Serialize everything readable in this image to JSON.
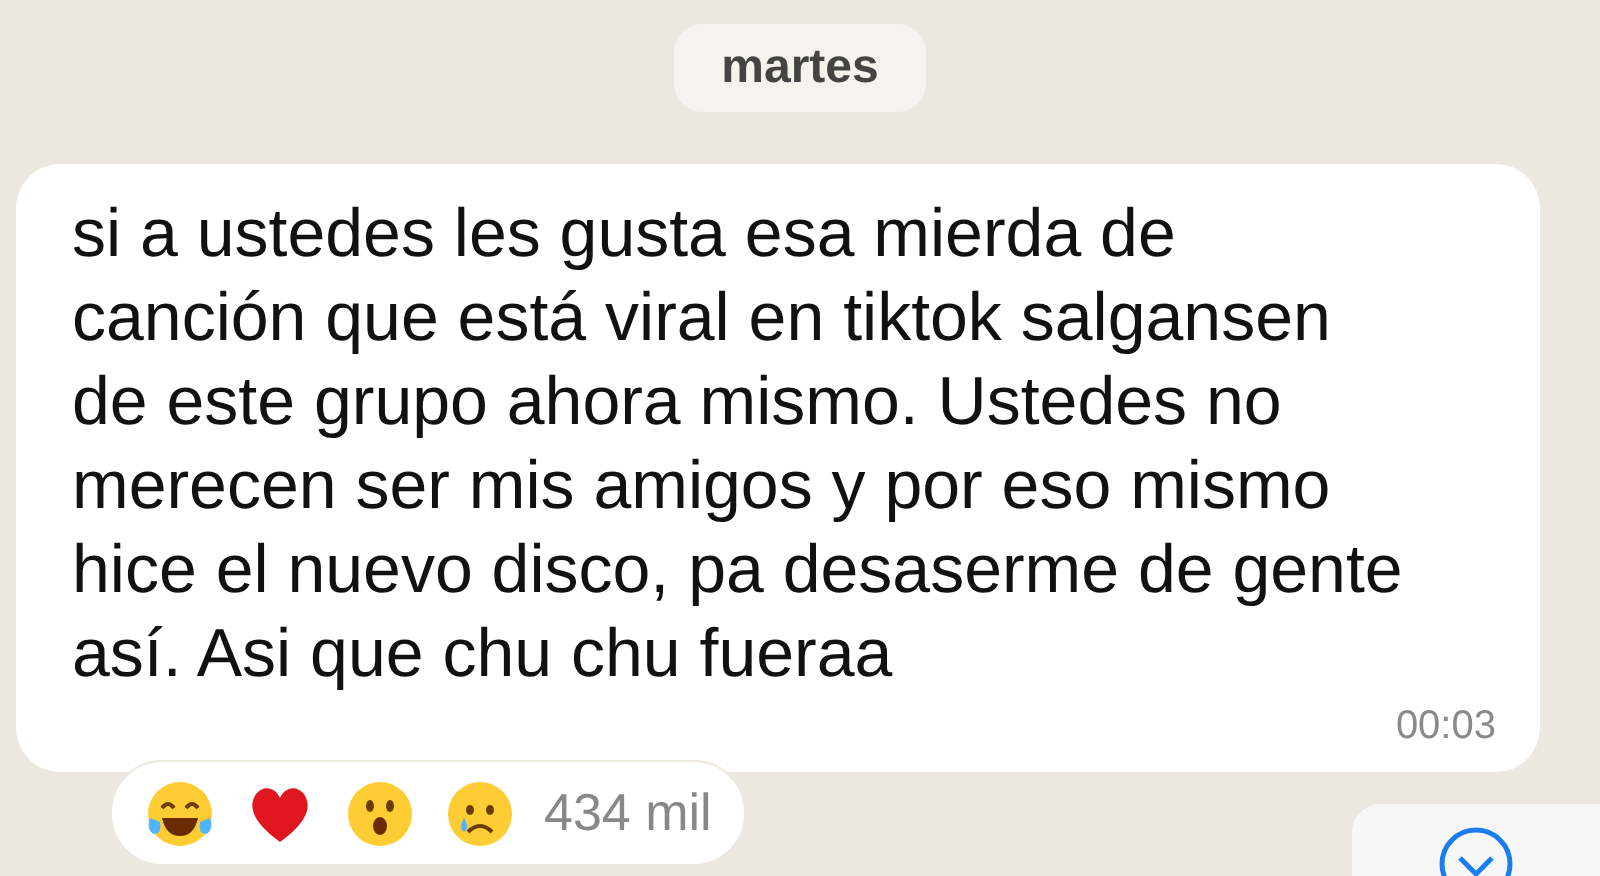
{
  "date_label": "martes",
  "message": {
    "text": "si a ustedes les gusta esa mierda de\ncanción que está viral en tiktok salgansen\nde este grupo ahora mismo. Ustedes no\nmerecen ser mis amigos y por eso mismo\nhice el nuevo disco, pa desaserme de gente\nasí. Asi que chu chu fueraa",
    "time": "00:03"
  },
  "reactions": {
    "count": "434 mil"
  }
}
